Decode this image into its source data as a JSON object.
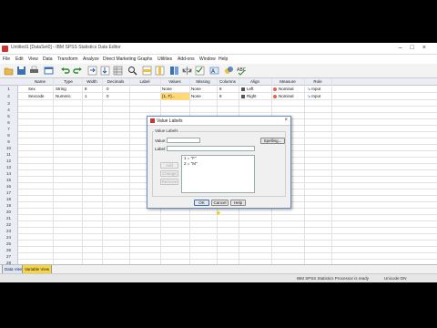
{
  "window": {
    "title": "Untitled1 [DataSet0] - IBM SPSS Statistics Data Editor"
  },
  "menu": [
    "File",
    "Edit",
    "View",
    "Data",
    "Transform",
    "Analyze",
    "Direct Marketing",
    "Graphs",
    "Utilities",
    "Add-ons",
    "Window",
    "Help"
  ],
  "grid": {
    "columns": [
      "Name",
      "Type",
      "Width",
      "Decimals",
      "Label",
      "Values",
      "Missing",
      "Columns",
      "Align",
      "Measure",
      "Role"
    ],
    "rows": [
      {
        "num": "1",
        "name": "Sex",
        "type": "String",
        "width": "8",
        "decimals": "0",
        "label": "",
        "values": "None",
        "missing": "None",
        "columns": "8",
        "align": "Left",
        "measure": "Nominal",
        "role": "Input"
      },
      {
        "num": "2",
        "name": "Sexcode",
        "type": "Numeric",
        "width": "1",
        "decimals": "0",
        "label": "",
        "values": "{1, F}...",
        "missing": "None",
        "columns": "8",
        "align": "Right",
        "measure": "Nominal",
        "role": "Input"
      }
    ],
    "empty_rows": [
      "3",
      "4",
      "5",
      "6",
      "7",
      "8",
      "9",
      "10",
      "11",
      "12",
      "13",
      "14",
      "15",
      "16",
      "17",
      "18",
      "19",
      "20",
      "21",
      "22",
      "23",
      "24",
      "25",
      "26",
      "27",
      "28",
      "29"
    ]
  },
  "tabs": {
    "data_view": "Data View",
    "variable_view": "Variable View"
  },
  "status": {
    "processor": "IBM SPSS Statistics Processor is ready",
    "encoding": "Unicode:ON"
  },
  "dialog": {
    "title": "Value Labels",
    "group_label": "Value Labels",
    "value_label": "Value:",
    "label_label": "Label:",
    "spelling": "Spelling...",
    "add": "Add",
    "change": "Change",
    "remove": "Remove",
    "list": [
      "1 = \"F\"",
      "2 = \"M\""
    ],
    "ok": "OK",
    "cancel": "Cancel",
    "help": "Help"
  }
}
